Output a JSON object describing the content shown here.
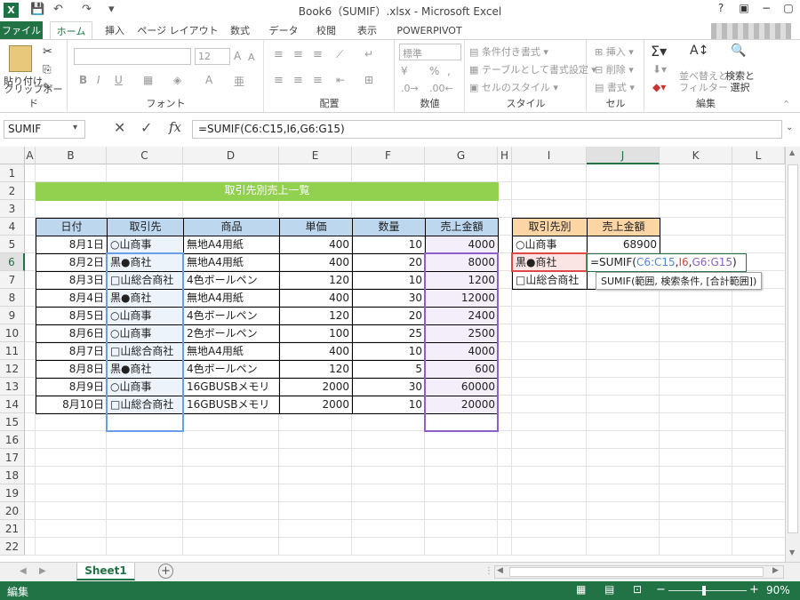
{
  "window": {
    "title": "Book6（SUMIF）.xlsx - Microsoft Excel"
  },
  "ribbon_tabs": [
    {
      "label": "ファイル",
      "state": "file"
    },
    {
      "label": "ホーム",
      "state": "active"
    },
    {
      "label": "挿入"
    },
    {
      "label": "ページ レイアウト"
    },
    {
      "label": "数式"
    },
    {
      "label": "データ"
    },
    {
      "label": "校閲"
    },
    {
      "label": "表示"
    },
    {
      "label": "POWERPIVOT"
    }
  ],
  "ribbon": {
    "clipboard": {
      "paste": "貼り付け",
      "label": "クリップボード"
    },
    "font": {
      "label": "フォント",
      "size": "12",
      "bold": "B",
      "italic": "I",
      "underline": "U"
    },
    "alignment": {
      "label": "配置"
    },
    "number": {
      "label": "数値",
      "format": "標準",
      "percent": "%",
      "comma": ","
    },
    "styles": {
      "label": "スタイル",
      "conditional": "条件付き書式",
      "table": "テーブルとして書式設定",
      "cell": "セルのスタイル"
    },
    "cells": {
      "label": "セル",
      "insert": "挿入",
      "delete": "削除",
      "format": "書式"
    },
    "editing": {
      "label": "編集",
      "sort": "並べ替えと\nフィルター",
      "find": "検索と\n選択"
    }
  },
  "formula_bar": {
    "name_box": "SUMIF",
    "fx": "fx",
    "formula": "=SUMIF(C6:C15,I6,G6:G15)"
  },
  "columns": [
    "A",
    "B",
    "C",
    "D",
    "E",
    "F",
    "G",
    "H",
    "I",
    "J",
    "K",
    "L"
  ],
  "rows": [
    "1",
    "2",
    "3",
    "4",
    "5",
    "6",
    "7",
    "8",
    "9",
    "10",
    "11",
    "12",
    "13",
    "14",
    "15",
    "16",
    "17",
    "18",
    "19",
    "20",
    "21",
    "22"
  ],
  "sheet": {
    "banner": "取引先別売上一覧",
    "headers": [
      "日付",
      "取引先",
      "商品",
      "単価",
      "数量",
      "売上金額"
    ],
    "data": [
      [
        "8月1日",
        "○山商事",
        "無地A4用紙",
        "400",
        "10",
        "4000"
      ],
      [
        "8月2日",
        "黒●商社",
        "無地A4用紙",
        "400",
        "20",
        "8000"
      ],
      [
        "8月3日",
        "□山総合商社",
        "4色ボールペン",
        "120",
        "10",
        "1200"
      ],
      [
        "8月4日",
        "黒●商社",
        "無地A4用紙",
        "400",
        "30",
        "12000"
      ],
      [
        "8月5日",
        "○山商事",
        "4色ボールペン",
        "120",
        "20",
        "2400"
      ],
      [
        "8月6日",
        "○山商事",
        "2色ボールペン",
        "100",
        "25",
        "2500"
      ],
      [
        "8月7日",
        "□山総合商社",
        "無地A4用紙",
        "400",
        "10",
        "4000"
      ],
      [
        "8月8日",
        "黒●商社",
        "4色ボールペン",
        "120",
        "5",
        "600"
      ],
      [
        "8月9日",
        "○山商事",
        "16GBUSBメモリ",
        "2000",
        "30",
        "60000"
      ],
      [
        "8月10日",
        "□山総合商社",
        "16GBUSBメモリ",
        "2000",
        "10",
        "20000"
      ]
    ],
    "summary_headers": [
      "取引先別",
      "売上金額"
    ],
    "summary": [
      {
        "name": "○山商事",
        "value": "68900"
      },
      {
        "name": "黒●商社",
        "value": ""
      },
      {
        "name": "□山総合商社",
        "value": ""
      }
    ],
    "edit_formula": {
      "eq": "=SUMIF(",
      "r1": "C6:C15",
      "c1": ",",
      "r2": "I6",
      "c2": ",",
      "r3": "G6:G15",
      "close": ")"
    },
    "tooltip": "SUMIF(範囲, 検索条件, [合計範囲])"
  },
  "sheet_tabs": {
    "active": "Sheet1",
    "add": "+"
  },
  "status": {
    "mode": "編集",
    "zoom": "90%"
  }
}
